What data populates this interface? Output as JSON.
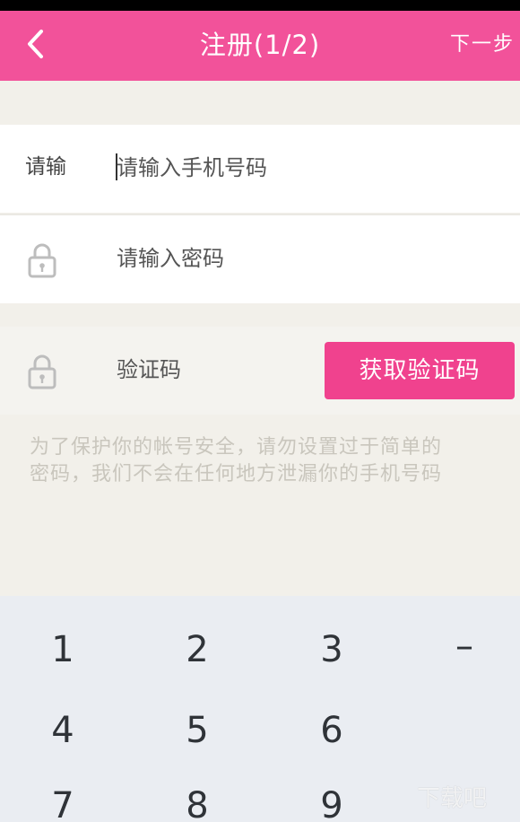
{
  "header": {
    "title": "注册(1/2)",
    "next_label": "下一步",
    "color": "#f2529a"
  },
  "form": {
    "phone": {
      "label": "请输",
      "placeholder": "请输入手机号码"
    },
    "password": {
      "placeholder": "请输入密码",
      "icon": "lock-icon"
    },
    "verification": {
      "label": "验证码",
      "icon": "lock-icon",
      "button_label": "获取验证码"
    }
  },
  "hint": {
    "lines": [
      "为了保护你的帐号安全，请勿设置过于简单的",
      "密码，我们不会在任何地方泄漏你的手机号码"
    ]
  },
  "keypad": {
    "keys": [
      "1",
      "2",
      "3",
      "–",
      "4",
      "5",
      "6",
      "7",
      "8",
      "9"
    ]
  },
  "watermark": {
    "text": "下载吧"
  },
  "colors": {
    "accent": "#f0428e",
    "background": "#f2f0ea",
    "keypad": "#eaedf2"
  }
}
